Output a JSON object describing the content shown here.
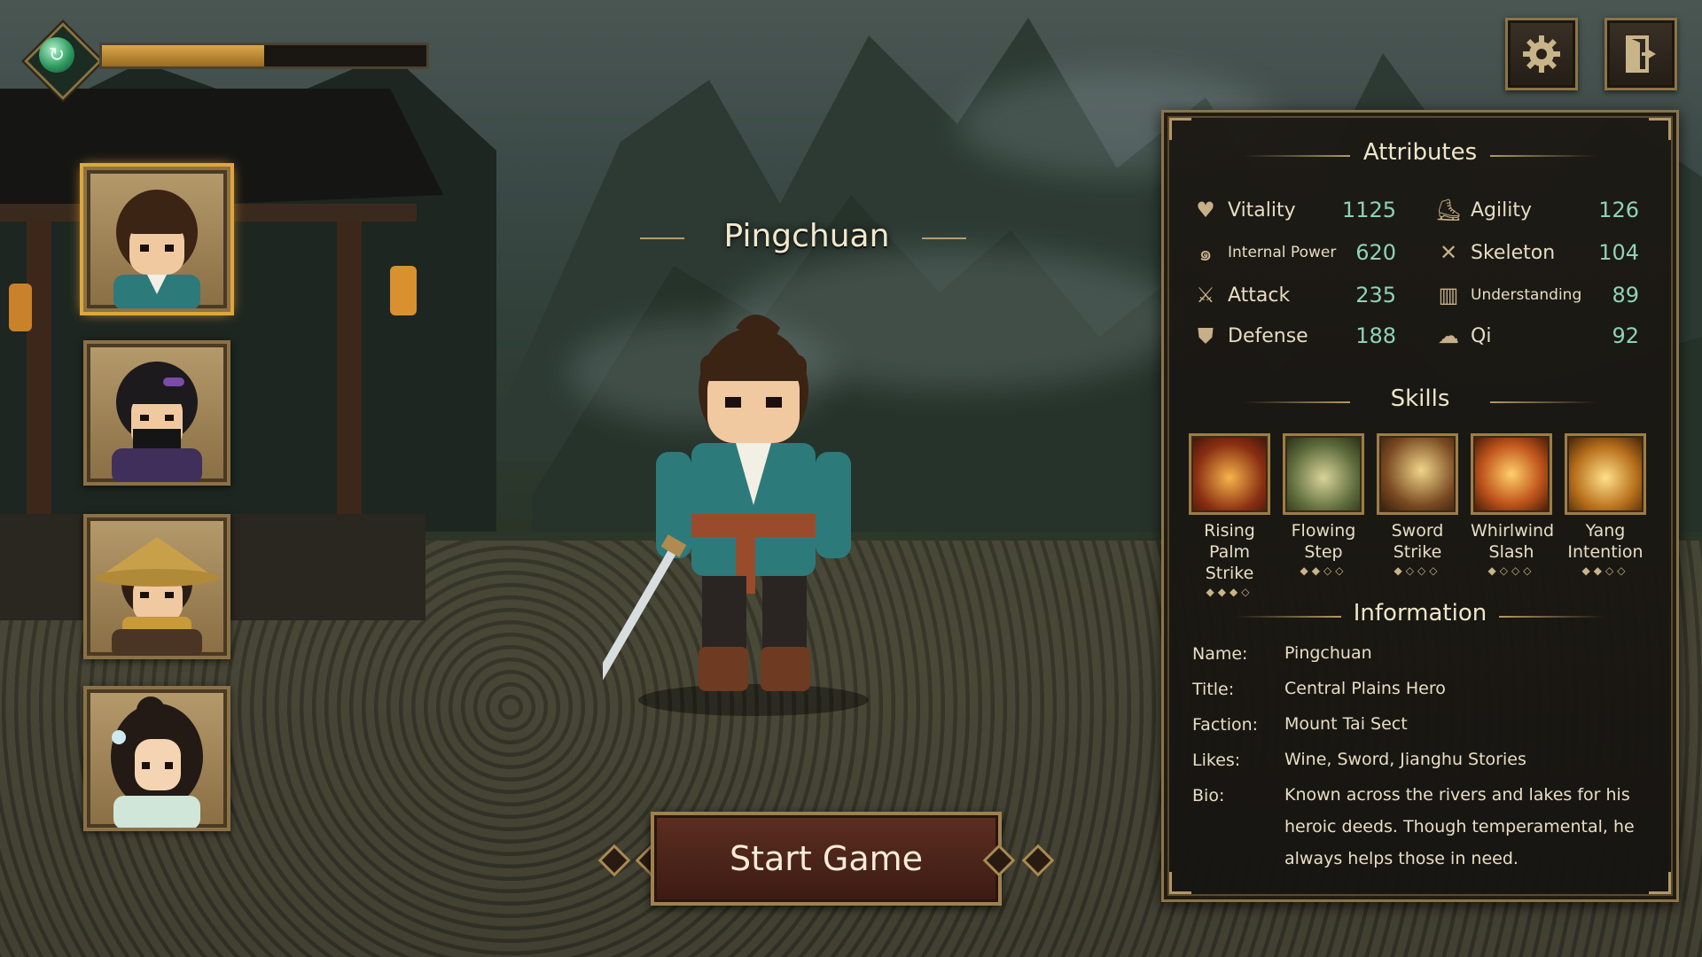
{
  "hero": {
    "name": "Pingchuan"
  },
  "status": {
    "gem_icon": "jade-swirl-icon",
    "progress": 0.5
  },
  "top_buttons": {
    "settings_icon": "gear-icon",
    "exit_icon": "exit-door-icon"
  },
  "portraits": [
    {
      "name": "Pingchuan portrait",
      "selected": true
    },
    {
      "name": "Masked ninja portrait",
      "selected": false
    },
    {
      "name": "Straw hat wanderer portrait",
      "selected": false
    },
    {
      "name": "Maiden portrait",
      "selected": false
    }
  ],
  "start_button": {
    "label": "Start Game"
  },
  "panel": {
    "attributes_title": "Attributes",
    "attributes_left": [
      {
        "label": "Vitality",
        "value": "1125",
        "icon": "heart-icon"
      },
      {
        "label": "Internal Power",
        "value": "620",
        "icon": "swirl-icon"
      },
      {
        "label": "Attack",
        "value": "235",
        "icon": "sword-icon"
      },
      {
        "label": "Defense",
        "value": "188",
        "icon": "shield-icon"
      }
    ],
    "attributes_right": [
      {
        "label": "Agility",
        "value": "126",
        "icon": "boot-icon"
      },
      {
        "label": "Skeleton",
        "value": "104",
        "icon": "bone-icon"
      },
      {
        "label": "Understanding",
        "value": "89",
        "icon": "book-icon"
      },
      {
        "label": "Qi",
        "value": "92",
        "icon": "cloud-swirl-icon"
      }
    ],
    "skills_title": "Skills",
    "skills": [
      {
        "line1": "Rising Palm",
        "line2": "Strike",
        "dots": "◆◆◆◇"
      },
      {
        "line1": "Flowing",
        "line2": "Step",
        "dots": "◆◆◇◇"
      },
      {
        "line1": "Sword",
        "line2": "Strike",
        "dots": "◆◇◇◇"
      },
      {
        "line1": "Whirlwind",
        "line2": "Slash",
        "dots": "◆◇◇◇"
      },
      {
        "line1": "Yang",
        "line2": "Intention",
        "dots": "◆◆◇◇"
      }
    ],
    "info_title": "Information",
    "info": [
      {
        "key": "Name:",
        "value": "Pingchuan"
      },
      {
        "key": "Title:",
        "value": "Central Plains Hero"
      },
      {
        "key": "Faction:",
        "value": "Mount Tai Sect"
      },
      {
        "key": "Likes:",
        "value": "Wine, Sword, Jianghu Stories"
      },
      {
        "key": "Bio:",
        "value": "Known across the rivers and lakes for his heroic deeds. Though temperamental, he always helps those in need."
      }
    ]
  },
  "colors": {
    "accent_gold": "#8c7449",
    "value_green": "#8fd3b6",
    "button_red": "#5c2e20"
  }
}
